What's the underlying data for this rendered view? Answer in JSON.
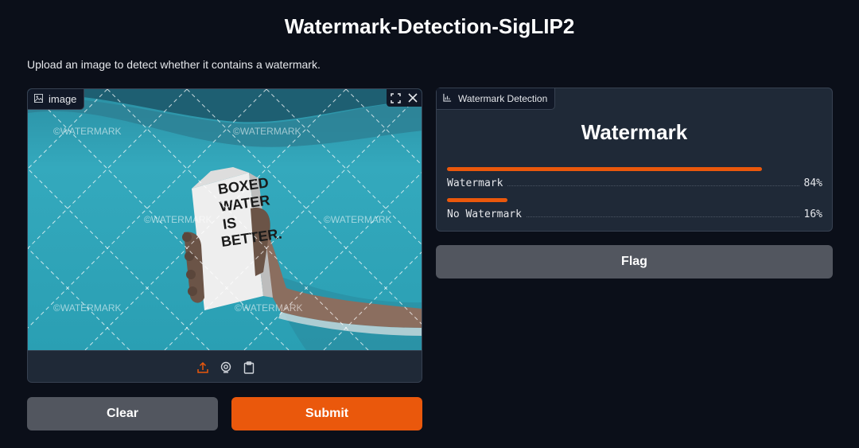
{
  "page": {
    "title": "Watermark-Detection-SigLIP2",
    "description": "Upload an image to detect whether it contains a watermark."
  },
  "image_input": {
    "label": "image",
    "watermark_text": "©WATERMARK",
    "carton_text": [
      "BOXED",
      "WATER",
      "IS",
      "BETTER."
    ],
    "icons": {
      "label": "image-icon",
      "fullscreen": "fullscreen-icon",
      "close": "close-icon",
      "upload": "upload-icon",
      "webcam": "webcam-icon",
      "clipboard": "clipboard-icon"
    }
  },
  "buttons": {
    "clear": "Clear",
    "submit": "Submit",
    "flag": "Flag"
  },
  "output": {
    "label": "Watermark Detection",
    "predicted": "Watermark",
    "confidences": [
      {
        "label": "Watermark",
        "value": 0.84,
        "display": "84%"
      },
      {
        "label": "No Watermark",
        "value": 0.16,
        "display": "16%"
      }
    ]
  },
  "colors": {
    "background": "#0b0f19",
    "panel": "#1f2937",
    "accent": "#ea580c",
    "secondary_button": "#52565f"
  }
}
